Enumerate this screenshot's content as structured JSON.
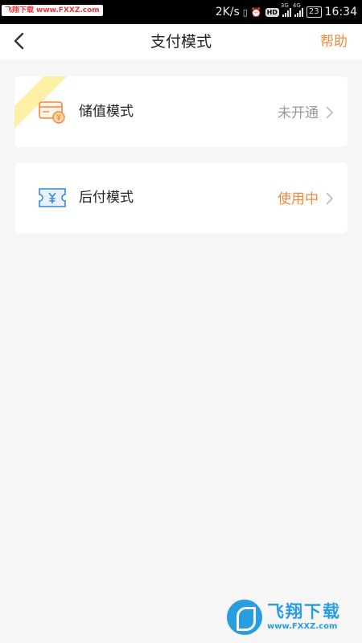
{
  "status_bar": {
    "watermark_cn": "飞翔下载",
    "watermark_url": "www.FXXZ.com",
    "net_speed": "2K/s",
    "hd": "HD",
    "sig1_tag": "3G",
    "sig2_tag": "4G",
    "battery": "23",
    "time": "16:34"
  },
  "header": {
    "title": "支付模式",
    "help_label": "帮助"
  },
  "cards": [
    {
      "label": "储值模式",
      "status": "未开通",
      "icon": "wallet-yen-icon"
    },
    {
      "label": "后付模式",
      "status": "使用中",
      "icon": "ticket-yen-icon"
    }
  ],
  "colors": {
    "accent": "#f08a3c",
    "muted": "#999999",
    "background": "#f6f6f6",
    "ribbon": "#fbf0a6"
  },
  "watermark": {
    "name": "飞翔下载",
    "url": "www.FXXZ.com"
  }
}
